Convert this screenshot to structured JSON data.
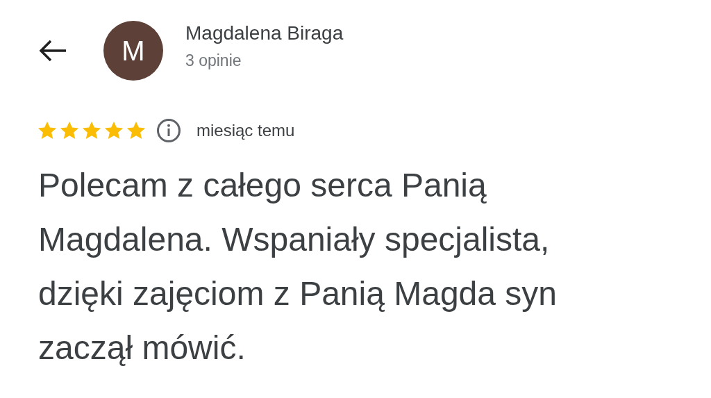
{
  "reviewer": {
    "avatar_letter": "M",
    "name": "Magdalena Biraga",
    "review_count": "3 opinie"
  },
  "review": {
    "stars": 5,
    "time": "miesiąc temu",
    "text": "Polecam z całego serca Panią Magdalena. Wspaniały specjalista, dzięki zajęciom z Panią Magda syn zaczął mówić."
  }
}
